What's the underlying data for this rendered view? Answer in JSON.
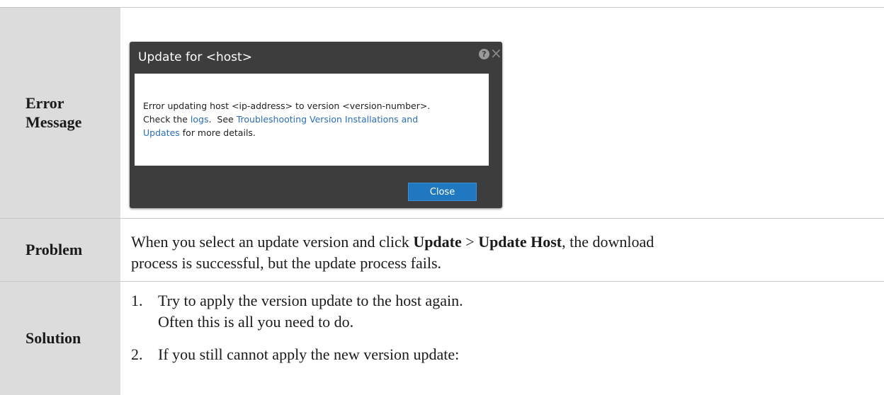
{
  "rows": {
    "error": {
      "label_line1": "Error",
      "label_line2": "Message"
    },
    "problem": {
      "label": "Problem",
      "text_1": "When you select an update version and click ",
      "bold_1": "Update",
      "text_2": " > ",
      "bold_2": "Update Host",
      "text_3": ", the download",
      "line_2": "process is successful, but the update process fails."
    },
    "solution": {
      "label": "Solution",
      "step_1_num": "1.",
      "step_1_text": "Try to apply the version update to the host again.",
      "step_1_sub": "Often this is all you need to do.",
      "step_2_num": "2.",
      "step_2_text": "If you still cannot apply the new version update:"
    }
  },
  "dialog": {
    "title": "Update for <host>",
    "help_icon": "?",
    "close_icon": "×",
    "message_line1": "Error updating host <ip-address> to version <version-number>.",
    "message_check": "Check the ",
    "message_logs_link": "logs",
    "message_see": ".  See ",
    "message_troubleshoot_link_1": "Troubleshooting Version Installations and",
    "message_troubleshoot_link_2": "Updates",
    "message_tail": " for more details.",
    "close_button": "Close"
  },
  "colors": {
    "label_bg": "#dcdcdc",
    "dialog_bg": "#3d3d3d",
    "link": "#2a6ebb",
    "button": "#1f78c0"
  }
}
